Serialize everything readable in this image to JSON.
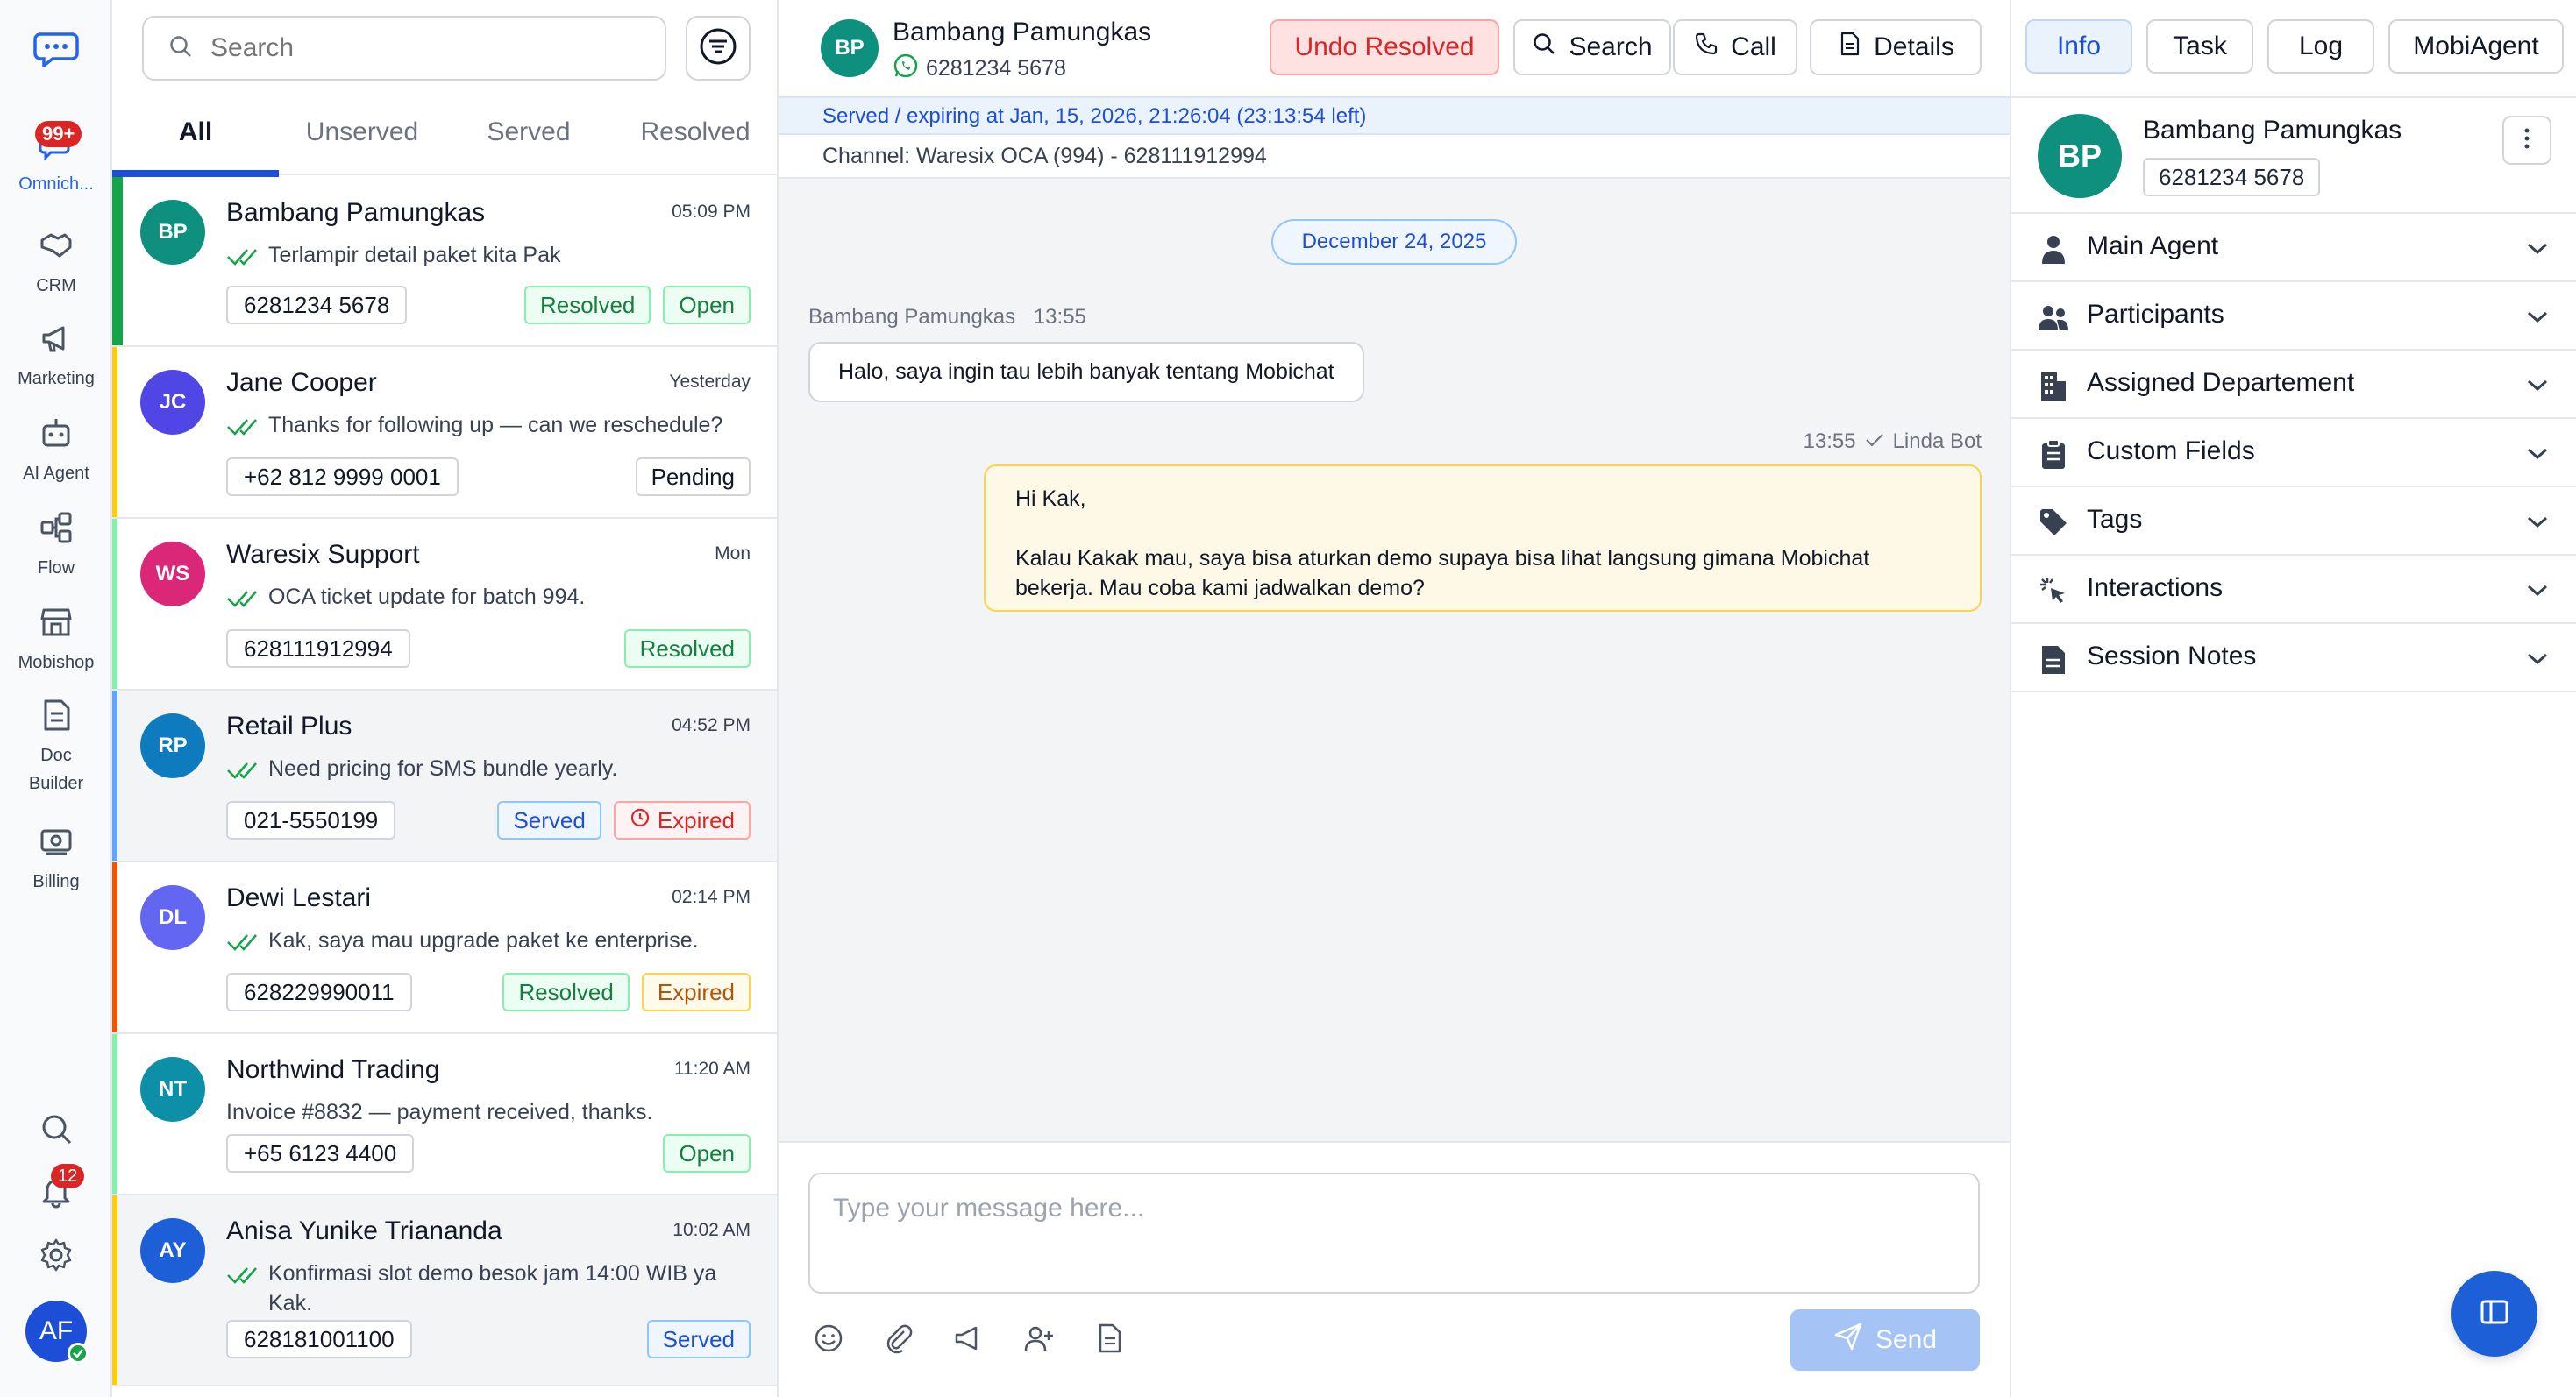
{
  "rail": {
    "items": [
      {
        "label": "Omnich...",
        "icon": "chat-bubble-icon",
        "badge": "99+"
      },
      {
        "label": "CRM",
        "icon": "handshake-icon"
      },
      {
        "label": "Marketing",
        "icon": "megaphone-icon"
      },
      {
        "label": "AI Agent",
        "icon": "robot-icon"
      },
      {
        "label": "Flow",
        "icon": "flow-icon"
      },
      {
        "label": "Mobishop",
        "icon": "store-icon"
      },
      {
        "label": "Doc Builder",
        "icon": "document-icon"
      },
      {
        "label": "Billing",
        "icon": "billing-icon"
      }
    ],
    "notifications": "12",
    "user_initials": "AF"
  },
  "list": {
    "search_placeholder": "Search",
    "tabs": [
      "All",
      "Unserved",
      "Served",
      "Resolved"
    ],
    "conversations": [
      {
        "initials": "BP",
        "name": "Bambang Pamungkas",
        "time": "05:09 PM",
        "preview": "Terlampir detail paket kita Pak",
        "phone": "6281234 5678",
        "tags": [
          "Resolved",
          "Open"
        ],
        "color": "#0f8f7e",
        "bar": "#16a34a"
      },
      {
        "initials": "JC",
        "name": "Jane Cooper",
        "time": "Yesterday",
        "preview": "Thanks for following up — can we reschedule?",
        "phone": "+62 812 9999 0001",
        "tags": [
          "Pending"
        ],
        "color": "#4f46e5",
        "bar": "#facc15"
      },
      {
        "initials": "WS",
        "name": "Waresix Support",
        "time": "Mon",
        "preview": "OCA ticket update for batch 994.",
        "phone": "628111912994",
        "tags": [
          "Resolved"
        ],
        "color": "#db2777",
        "bar": "#86efac"
      },
      {
        "initials": "RP",
        "name": "Retail Plus",
        "time": "04:52 PM",
        "preview": "Need pricing for SMS bundle yearly.",
        "phone": "021-5550199",
        "tags": [
          "Served",
          "Expired"
        ],
        "color": "#0e7bbf",
        "bar": "#60a5fa"
      },
      {
        "initials": "DL",
        "name": "Dewi Lestari",
        "time": "02:14 PM",
        "preview": "Kak, saya mau upgrade paket ke enterprise.",
        "phone": "628229990011",
        "tags": [
          "Resolved",
          "Expired"
        ],
        "color": "#6366f1",
        "bar": "#ea580c"
      },
      {
        "initials": "NT",
        "name": "Northwind Trading",
        "time": "11:20 AM",
        "preview": "Invoice #8832 — payment received, thanks.",
        "phone": "+65 6123 4400",
        "tags": [
          "Open"
        ],
        "color": "#0e8fa8",
        "bar": "#86efac"
      },
      {
        "initials": "AY",
        "name": "Anisa Yunike Triananda",
        "time": "10:02 AM",
        "preview": "Konfirmasi slot demo besok jam 14:00 WIB ya Kak.",
        "phone": "628181001100",
        "tags": [
          "Served"
        ],
        "color": "#1d5fd6",
        "bar": "#facc15"
      }
    ]
  },
  "chat": {
    "initials": "BP",
    "name": "Bambang Pamungkas",
    "phone": "6281234 5678",
    "buttons": {
      "undo": "Undo Resolved",
      "search": "Search",
      "call": "Call",
      "details": "Details"
    },
    "status": "Served / expiring at Jan, 15, 2026, 21:26:04 (23:13:54 left)",
    "channel": "Channel: Waresix OCA (994) - 628111912994",
    "date": "December 24, 2025",
    "incoming": {
      "sender": "Bambang Pamungkas",
      "time": "13:55",
      "text": "Halo, saya ingin tau lebih banyak tentang Mobichat"
    },
    "outgoing": {
      "time": "13:55",
      "sender": "Linda Bot",
      "text": "Hi Kak,\n\nKalau Kakak mau, saya bisa aturkan demo supaya bisa lihat langsung gimana Mobichat bekerja. Mau coba kami jadwalkan demo?"
    },
    "composer_placeholder": "Type your message here...",
    "send": "Send"
  },
  "info": {
    "tabs": [
      "Info",
      "Task",
      "Log",
      "MobiAgent"
    ],
    "initials": "BP",
    "name": "Bambang Pamungkas",
    "phone": "6281234 5678",
    "sections": [
      {
        "label": "Main Agent",
        "icon": "person-icon"
      },
      {
        "label": "Participants",
        "icon": "people-icon"
      },
      {
        "label": "Assigned Departement",
        "icon": "building-icon"
      },
      {
        "label": "Custom Fields",
        "icon": "clipboard-icon"
      },
      {
        "label": "Tags",
        "icon": "tag-icon"
      },
      {
        "label": "Interactions",
        "icon": "pointer-click-icon"
      },
      {
        "label": "Session Notes",
        "icon": "note-icon"
      }
    ]
  },
  "colors": {
    "accent": "#1d4ed8",
    "success": "#15803d",
    "danger": "#dc2626",
    "warning": "#b45309"
  }
}
